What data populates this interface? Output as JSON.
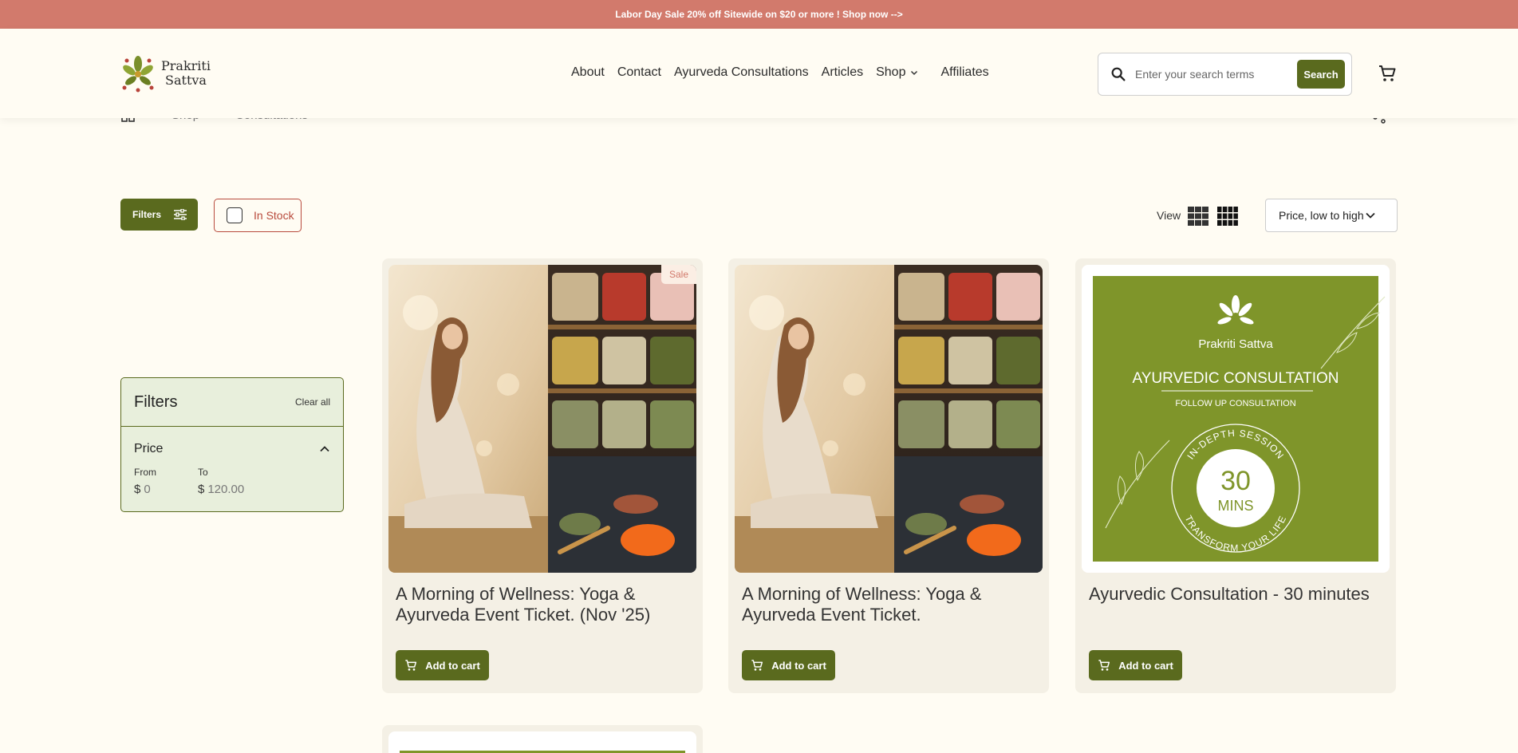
{
  "announcement": {
    "text": "Labor Day Sale 20% off Sitewide on $20 or more ! Shop now -->"
  },
  "header": {
    "logo_line1": "Prakriti",
    "logo_line2": "Sattva",
    "nav": [
      "About",
      "Contact",
      "Ayurveda Consultations",
      "Articles",
      "Shop",
      "Affiliates"
    ],
    "search_placeholder": "Enter your search terms",
    "search_button": "Search"
  },
  "breadcrumb": {
    "items": [
      "Shop",
      "Consultations"
    ]
  },
  "toolbar": {
    "filters_label": "Filters",
    "in_stock_label": "In Stock",
    "view_label": "View",
    "sort_selected": "Price, low to high"
  },
  "filter_panel": {
    "title": "Filters",
    "clear_label": "Clear all",
    "price_label": "Price",
    "from_label": "From",
    "to_label": "To",
    "currency": "$",
    "from_value": "0",
    "to_value": "120.00"
  },
  "products": [
    {
      "title": "A Morning of Wellness: Yoga & Ayurveda Event Ticket. (Nov '25)",
      "badge": "Sale",
      "button": "Add to cart"
    },
    {
      "title": "A Morning of Wellness: Yoga & Ayurveda Event Ticket.",
      "button": "Add to cart"
    },
    {
      "title": "Ayurvedic Consultation - 30 minutes",
      "button": "Add to cart"
    }
  ],
  "consult_image": {
    "brand": "Prakriti Sattva",
    "heading": "AYURVEDIC CONSULTATION",
    "subheading": "FOLLOW UP CONSULTATION",
    "ring_top": "IN-DEPTH SESSION",
    "ring_bottom": "TRANSFORM YOUR LIFE",
    "number": "30",
    "unit": "MINS"
  },
  "colors": {
    "announce": "#d27a6c",
    "brand_green": "#5a6a1e",
    "consult_green": "#7f952a",
    "background": "#fffcf3"
  }
}
